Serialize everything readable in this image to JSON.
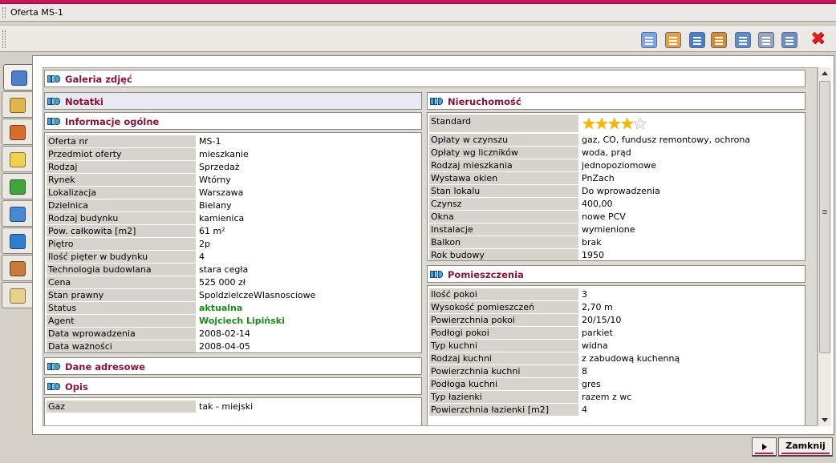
{
  "window": {
    "title": "Oferta MS-1"
  },
  "colors": {
    "accent": "#c8145a",
    "header_text": "#8c1138",
    "highlight_green": "#1b8a1b"
  },
  "toolbar": {
    "buttons": [
      {
        "icon": "copy-document-icon",
        "color": "#7fa6e0"
      },
      {
        "icon": "print-preview-icon",
        "color": "#e8a23c"
      },
      {
        "icon": "calendar-window-icon",
        "color": "#4a7cc8"
      },
      {
        "icon": "house-export-icon",
        "color": "#d98a2b"
      },
      {
        "icon": "calculator-icon",
        "color": "#5e8cc4"
      },
      {
        "icon": "printer-icon",
        "color": "#9aa6b8"
      },
      {
        "icon": "document-edit-icon",
        "color": "#6f8fbf"
      }
    ],
    "close_icon": "close-icon"
  },
  "side_tabs": [
    {
      "icon": "window-icon",
      "color": "#4d7fcf"
    },
    {
      "icon": "brush-icon",
      "color": "#e0b54a"
    },
    {
      "icon": "house-icon",
      "color": "#d96d2c"
    },
    {
      "icon": "notepad-pencil-icon",
      "color": "#f0d050"
    },
    {
      "icon": "folder-icon",
      "color": "#3da63d"
    },
    {
      "icon": "picture-icon",
      "color": "#4a88d6"
    },
    {
      "icon": "globe-icon",
      "color": "#2f7fd0"
    },
    {
      "icon": "users-icon",
      "color": "#c87a3a"
    },
    {
      "icon": "book-icon",
      "color": "#e8d28a"
    }
  ],
  "sections": {
    "galeria": "Galeria zdjęć",
    "notatki": "Notatki",
    "informacje": "Informacje ogólne",
    "dane_adresowe": "Dane adresowe",
    "opis": "Opis",
    "nieruchomosc": "Nieruchomość",
    "pomieszczenia": "Pomieszczenia"
  },
  "informacje_rows": [
    {
      "label": "Oferta nr",
      "value": "MS-1"
    },
    {
      "label": "Przedmiot oferty",
      "value": "mieszkanie"
    },
    {
      "label": "Rodzaj",
      "value": "Sprzedaż"
    },
    {
      "label": "Rynek",
      "value": "Wtórny"
    },
    {
      "label": "Lokalizacja",
      "value": "Warszawa"
    },
    {
      "label": "Dzielnica",
      "value": "Bielany"
    },
    {
      "label": "Rodzaj budynku",
      "value": "kamienica"
    },
    {
      "label": "Pow. całkowita [m2]",
      "value": "61 m²"
    },
    {
      "label": "Piętro",
      "value": "2p"
    },
    {
      "label": "Ilość pięter w budynku",
      "value": "4"
    },
    {
      "label": "Technologia budowlana",
      "value": "stara cegła"
    },
    {
      "label": "Cena",
      "value": "525 000 zł"
    },
    {
      "label": "Stan prawny",
      "value": "SpoldzielczeWlasnosciowe"
    },
    {
      "label": "Status",
      "value": "aktualna",
      "green": true
    },
    {
      "label": "Agent",
      "value": "Wojciech Lipiński",
      "green": true
    },
    {
      "label": "Data wprowadzenia",
      "value": "2008-02-14"
    },
    {
      "label": "Data ważności",
      "value": "2008-04-05"
    }
  ],
  "opis_rows": [
    {
      "label": "Gaz",
      "value": "tak - miejski"
    }
  ],
  "nieruchomosc": {
    "standard_label": "Standard",
    "standard_rating": 4,
    "standard_max": 5,
    "rows": [
      {
        "label": "Opłaty w czynszu",
        "value": "gaz, CO, fundusz remontowy, ochrona"
      },
      {
        "label": "Opłaty wg liczników",
        "value": "woda, prąd"
      },
      {
        "label": "Rodzaj mieszkania",
        "value": "jednopoziomowe"
      },
      {
        "label": "Wystawa okien",
        "value": "PnZach"
      },
      {
        "label": "Stan lokalu",
        "value": "Do wprowadzenia"
      },
      {
        "label": "Czynsz",
        "value": "400,00"
      },
      {
        "label": "Okna",
        "value": "nowe PCV"
      },
      {
        "label": "Instalacje",
        "value": "wymienione"
      },
      {
        "label": "Balkon",
        "value": "brak"
      },
      {
        "label": "Rok budowy",
        "value": "1950"
      }
    ]
  },
  "pomieszczenia_rows": [
    {
      "label": "Ilość pokoi",
      "value": "3"
    },
    {
      "label": "Wysokość pomieszczeń",
      "value": "2,70 m"
    },
    {
      "label": "Powierzchnia pokoi",
      "value": "20/15/10"
    },
    {
      "label": "Podłogi pokoi",
      "value": "parkiet"
    },
    {
      "label": "Typ kuchni",
      "value": "widna"
    },
    {
      "label": "Rodzaj kuchni",
      "value": "z zabudową kuchenną"
    },
    {
      "label": "Powierzchnia kuchni",
      "value": "8"
    },
    {
      "label": "Podłoga kuchni",
      "value": "gres"
    },
    {
      "label": "Typ łazienki",
      "value": "razem z wc"
    },
    {
      "label": "Powierzchnia łazienki [m2]",
      "value": "4"
    }
  ],
  "footer": {
    "close_label": "Zamknij"
  }
}
